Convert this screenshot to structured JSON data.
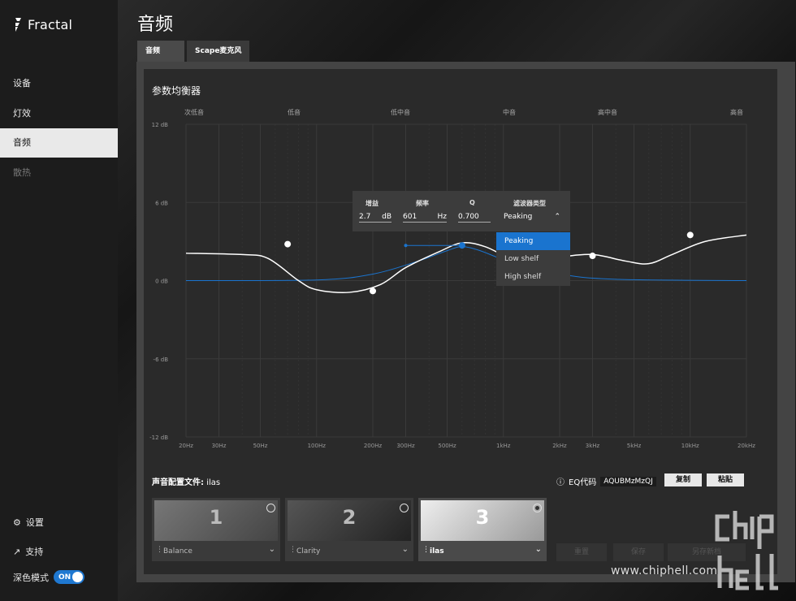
{
  "brand": {
    "name": "Fractal"
  },
  "sidebar": {
    "items": [
      {
        "label": "设备"
      },
      {
        "label": "灯效"
      },
      {
        "label": "音频"
      },
      {
        "label": "散热"
      }
    ],
    "settings": "设置",
    "support": "支持",
    "dark_mode": {
      "label": "深色模式",
      "state": "ON"
    }
  },
  "page": {
    "title": "音频"
  },
  "tabs": [
    {
      "label": "音频"
    },
    {
      "label": "Scape麦克风"
    }
  ],
  "eq": {
    "title": "参数均衡器",
    "bands": [
      "次低音",
      "低音",
      "低中音",
      "中音",
      "高中音",
      "高音"
    ],
    "db_labels": [
      "12 dB",
      "6 dB",
      "0 dB",
      "-6 dB",
      "-12 dB"
    ],
    "db_values": [
      12,
      6,
      0,
      -6,
      -12
    ],
    "freq_labels": [
      "20Hz",
      "30Hz",
      "50Hz",
      "100Hz",
      "200Hz",
      "300Hz",
      "500Hz",
      "1kHz",
      "2kHz",
      "3kHz",
      "5kHz",
      "10kHz",
      "20kHz"
    ],
    "freq_values": [
      20,
      30,
      50,
      100,
      200,
      300,
      500,
      1000,
      2000,
      3000,
      5000,
      10000,
      20000
    ],
    "points": [
      {
        "hz": 70,
        "db": 2.8
      },
      {
        "hz": 200,
        "db": -0.8
      },
      {
        "hz": 601,
        "db": 2.7
      },
      {
        "hz": 3000,
        "db": 1.9
      },
      {
        "hz": 10000,
        "db": 3.5
      }
    ],
    "curve": [
      {
        "hz": 20,
        "db": 2.1
      },
      {
        "hz": 40,
        "db": 2.0
      },
      {
        "hz": 55,
        "db": 1.7
      },
      {
        "hz": 80,
        "db": 0
      },
      {
        "hz": 100,
        "db": -0.7
      },
      {
        "hz": 150,
        "db": -0.9
      },
      {
        "hz": 220,
        "db": -0.3
      },
      {
        "hz": 300,
        "db": 1.0
      },
      {
        "hz": 450,
        "db": 2.2
      },
      {
        "hz": 601,
        "db": 2.9
      },
      {
        "hz": 800,
        "db": 2.6
      },
      {
        "hz": 1100,
        "db": 1.7
      },
      {
        "hz": 1500,
        "db": 1.5
      },
      {
        "hz": 2000,
        "db": 1.8
      },
      {
        "hz": 3000,
        "db": 2.0
      },
      {
        "hz": 4500,
        "db": 1.5
      },
      {
        "hz": 6000,
        "db": 1.3
      },
      {
        "hz": 8000,
        "db": 2.0
      },
      {
        "hz": 12000,
        "db": 3.0
      },
      {
        "hz": 20000,
        "db": 3.5
      }
    ],
    "selected_curve": [
      {
        "hz": 20,
        "db": 0
      },
      {
        "hz": 100,
        "db": 0.05
      },
      {
        "hz": 200,
        "db": 0.5
      },
      {
        "hz": 350,
        "db": 1.5
      },
      {
        "hz": 500,
        "db": 2.3
      },
      {
        "hz": 601,
        "db": 2.6
      },
      {
        "hz": 750,
        "db": 2.3
      },
      {
        "hz": 1100,
        "db": 1.4
      },
      {
        "hz": 2000,
        "db": 0.5
      },
      {
        "hz": 4000,
        "db": 0.1
      },
      {
        "hz": 20000,
        "db": 0
      }
    ],
    "q_handle": {
      "hz_low": 300,
      "hz_high": 601,
      "db": 2.7
    },
    "popup": {
      "gain_label": "增益",
      "gain_value": "2.7",
      "gain_unit": "dB",
      "freq_label": "频率",
      "freq_value": "601",
      "freq_unit": "Hz",
      "q_label": "Q",
      "q_value": "0.700",
      "filter_label": "滤波器类型",
      "filter_value": "Peaking"
    },
    "filter_options": [
      "Peaking",
      "Low shelf",
      "High shelf"
    ],
    "colors": {
      "curve": "#ffffff",
      "selected": "#1a74cf",
      "grid": "#3a3a3a"
    }
  },
  "profile": {
    "label": "声音配置文件:",
    "current": "ilas",
    "eq_code_label": "EQ代码",
    "eq_code": "AQUBMzMzQJ",
    "copy": "复制",
    "paste": "粘贴",
    "cards": [
      {
        "num": "1",
        "name": "Balance"
      },
      {
        "num": "2",
        "name": "Clarity"
      },
      {
        "num": "3",
        "name": "ilas",
        "selected": true
      }
    ],
    "actions": [
      "重置",
      "保存",
      "另存新档"
    ]
  },
  "watermark": {
    "text": "www.chiphell.com",
    "logo": "chip hell"
  }
}
